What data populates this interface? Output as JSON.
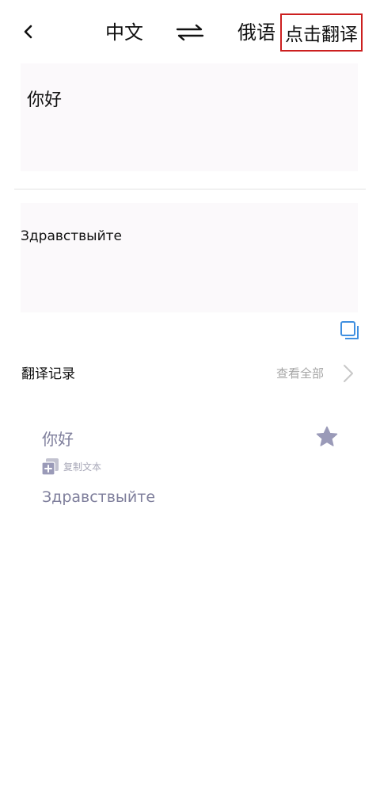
{
  "header": {
    "back_icon": "chevron-left-icon",
    "source_language": "中文",
    "swap_icon": "swap-arrows-icon",
    "target_language": "俄语",
    "translate_label": "点击翻译",
    "highlight_color": "#cc1f1f"
  },
  "input": {
    "text": "你好"
  },
  "output": {
    "text": "Здравствыйте",
    "copy_icon": "copy-icon",
    "accent": "#3f8fe0"
  },
  "history": {
    "title": "翻译记录",
    "view_all": "查看全部",
    "records": [
      {
        "source": "你好",
        "copy_label": "复制文本",
        "target": "Здравствыйте",
        "star_icon": "star-icon",
        "text_color": "#7f7f9c"
      }
    ]
  }
}
